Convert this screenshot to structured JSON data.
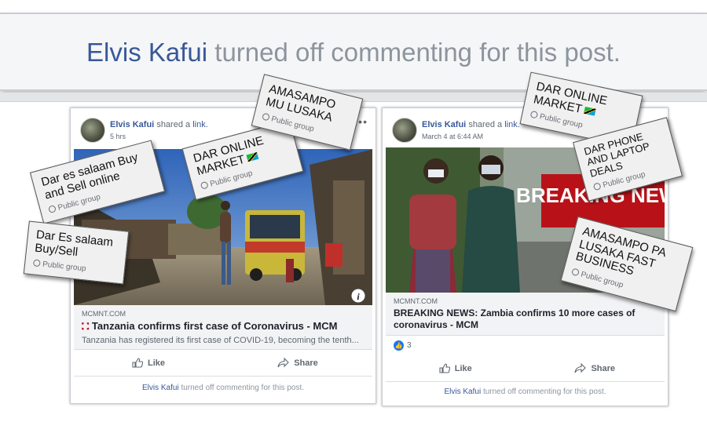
{
  "banner": {
    "name": "Elvis Kafui",
    "text": "turned off commenting for this post."
  },
  "posts": [
    {
      "author": "Elvis Kafui",
      "shared": "shared a",
      "link_word": "link.",
      "time": "5 hrs",
      "domain": "MCMNT.COM",
      "title": "Tanzania confirms first case of Coronavirus - MCM",
      "description": "Tanzania has registered its first case of COVID-19, becoming the tenth...",
      "like_label": "Like",
      "share_label": "Share",
      "footer_name": "Elvis Kafui",
      "footer_text": "turned off commenting for this post."
    },
    {
      "author": "Elvis Kafui",
      "shared": "shared a",
      "link_word": "link.",
      "time": "March 4 at 6:44 AM",
      "domain": "MCMNT.COM",
      "title": "BREAKING NEWS: Zambia confirms 10 more cases of coronavirus - MCM",
      "image_text": "BREAKING NEWS",
      "reactions": "3",
      "like_label": "Like",
      "share_label": "Share",
      "footer_name": "Elvis Kafui",
      "footer_text": "turned off commenting for this post."
    }
  ],
  "groups": [
    {
      "name": "Dar es salaam Buy and Sell online",
      "type": "Public group"
    },
    {
      "name": "Dar Es salaam Buy/Sell",
      "type": "Public group"
    },
    {
      "name": "DAR ONLINE MARKET",
      "type": "Public group"
    },
    {
      "name": "AMASAMPO MU LUSAKA",
      "type": "Public group"
    },
    {
      "name": "DAR ONLINE MARKET",
      "type": "Public group"
    },
    {
      "name": "DAR PHONE AND LAPTOP DEALS",
      "type": "Public group"
    },
    {
      "name": "AMASAMPO PA LUSAKA FAST BUSINESS",
      "type": "Public group"
    }
  ],
  "colors": {
    "link_blue": "#385898",
    "muted_gray": "#8d949e",
    "like_blue": "#1877f2",
    "breaking_red": "#c0121c"
  }
}
